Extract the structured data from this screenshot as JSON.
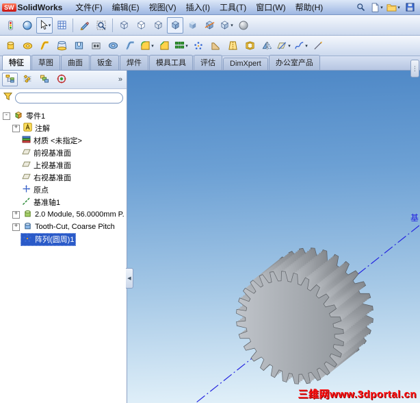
{
  "title_bar": {
    "logo_text": "SW",
    "app_name": "SolidWorks",
    "menus": [
      "文件(F)",
      "编辑(E)",
      "视图(V)",
      "插入(I)",
      "工具(T)",
      "窗口(W)",
      "帮助(H)"
    ],
    "quick_tools": [
      {
        "name": "solidworks-search",
        "icon": "search-icon"
      },
      {
        "name": "new-document",
        "icon": "new-doc-icon",
        "dropdown": true
      },
      {
        "name": "open-document",
        "icon": "open-folder-icon",
        "dropdown": true
      },
      {
        "name": "save-document",
        "icon": "save-icon"
      }
    ]
  },
  "toolbar_view": {
    "buttons": [
      {
        "name": "rebuild",
        "icon": "rebuild-icon"
      },
      {
        "name": "edit-appearance",
        "icon": "appearance-icon"
      },
      {
        "name": "select",
        "icon": "cursor-icon",
        "pressed": true,
        "dropdown": true
      },
      {
        "name": "grid-system",
        "icon": "grid-icon"
      },
      {
        "separator": true
      },
      {
        "name": "sketch",
        "icon": "pencil-icon"
      },
      {
        "name": "zoom-to-fit",
        "icon": "zoom-fit-icon"
      },
      {
        "separator": true
      },
      {
        "name": "view-wireframe",
        "icon": "cube-wire-icon"
      },
      {
        "name": "view-hidden-lines-visible",
        "icon": "cube-hlv-icon"
      },
      {
        "name": "view-hidden-lines-removed",
        "icon": "cube-hlr-icon"
      },
      {
        "name": "view-shaded-with-edges",
        "icon": "cube-shaded-edges-icon",
        "pressed": true
      },
      {
        "name": "view-shaded",
        "icon": "cube-shaded-icon"
      },
      {
        "name": "section-view",
        "icon": "section-icon"
      },
      {
        "name": "view-orientation",
        "icon": "cube-iso-icon",
        "dropdown": true
      },
      {
        "name": "apply-scene",
        "icon": "sphere-icon"
      }
    ]
  },
  "toolbar_features": {
    "buttons": [
      {
        "name": "extruded-boss",
        "icon": "extrude-boss-icon"
      },
      {
        "name": "revolved-boss",
        "icon": "revolve-boss-icon"
      },
      {
        "name": "swept-boss",
        "icon": "sweep-icon"
      },
      {
        "name": "lofted-boss",
        "icon": "loft-icon"
      },
      {
        "name": "extruded-cut",
        "icon": "extrude-cut-icon"
      },
      {
        "name": "hole-wizard",
        "icon": "hole-wizard-icon"
      },
      {
        "name": "revolved-cut",
        "icon": "revolve-cut-icon"
      },
      {
        "name": "swept-cut",
        "icon": "sweep-cut-icon"
      },
      {
        "name": "fillet",
        "icon": "fillet-icon",
        "dropdown": true
      },
      {
        "name": "chamfer",
        "icon": "chamfer-icon"
      },
      {
        "name": "linear-pattern",
        "icon": "linear-pattern-icon",
        "dropdown": true
      },
      {
        "name": "circular-pattern",
        "icon": "circular-pattern-icon"
      },
      {
        "name": "rib",
        "icon": "rib-icon"
      },
      {
        "name": "draft",
        "icon": "draft-icon"
      },
      {
        "name": "shell",
        "icon": "shell-icon"
      },
      {
        "name": "mirror",
        "icon": "mirror-icon"
      },
      {
        "name": "reference-geometry",
        "icon": "ref-geometry-icon",
        "dropdown": true
      },
      {
        "name": "curves",
        "icon": "curves-icon",
        "dropdown": true
      },
      {
        "name": "instant3d",
        "icon": "instant3d-icon"
      }
    ]
  },
  "command_tabs": {
    "items": [
      {
        "label": "特征",
        "active": true
      },
      {
        "label": "草图"
      },
      {
        "label": "曲面"
      },
      {
        "label": "钣金"
      },
      {
        "label": "焊件"
      },
      {
        "label": "模具工具"
      },
      {
        "label": "评估"
      },
      {
        "label": "DimXpert"
      },
      {
        "label": "办公室产品"
      }
    ]
  },
  "feature_tree": {
    "panel_tabs": [
      {
        "name": "featuremanager-tab",
        "icon": "fm-tree-icon"
      },
      {
        "name": "propertymanager-tab",
        "icon": "pm-icon"
      },
      {
        "name": "configurationmanager-tab",
        "icon": "cfg-icon"
      },
      {
        "name": "dimxpertmanager-tab",
        "icon": "dx-icon"
      }
    ],
    "overflow_label": "»",
    "filter_icon": "funnel-icon",
    "filter_value": "",
    "collapse_arrow": "◀",
    "items": [
      {
        "label": "零件1",
        "icon": "part-icon",
        "expander": "-"
      },
      {
        "label": "注解",
        "icon": "annotations-icon",
        "expander": "+"
      },
      {
        "label": "材质 <未指定>",
        "icon": "material-icon",
        "expander": ""
      },
      {
        "label": "前视基准面",
        "icon": "plane-icon",
        "expander": ""
      },
      {
        "label": "上视基准面",
        "icon": "plane-icon",
        "expander": ""
      },
      {
        "label": "右视基准面",
        "icon": "plane-icon",
        "expander": ""
      },
      {
        "label": "原点",
        "icon": "origin-icon",
        "expander": ""
      },
      {
        "label": "基准轴1",
        "icon": "axis-icon",
        "expander": ""
      },
      {
        "label": "2.0 Module, 56.0000mm P.",
        "icon": "gear-feature-icon",
        "expander": "+"
      },
      {
        "label": "Tooth-Cut, Coarse Pitch",
        "icon": "tooth-cut-icon",
        "expander": "+"
      },
      {
        "label": "阵列(圆周)1",
        "icon": "circular-pattern-icon",
        "expander": "",
        "selected": true
      }
    ]
  },
  "viewport": {
    "axis_label": "基",
    "watermark": "三维网www.3dportal.cn",
    "corner_glyph": "⋮",
    "colors": {
      "selection_blue": "#2a5ac8",
      "axis_line": "#2424e0",
      "watermark_red": "#ff1212",
      "gradient_top": "#4d87c6",
      "gradient_bottom": "#e4f2fa",
      "gear_gray": "#a8adb3"
    }
  }
}
